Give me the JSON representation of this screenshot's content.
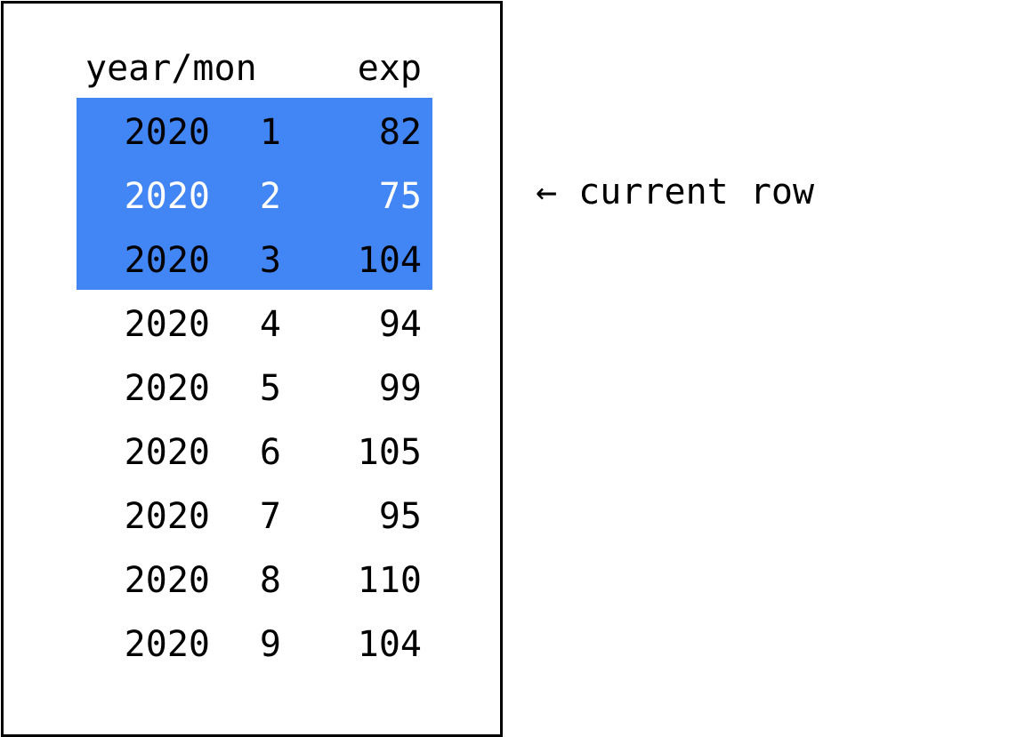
{
  "table": {
    "headers": {
      "year_mon": "year/mon",
      "exp": "exp"
    },
    "rows": [
      {
        "year": "2020",
        "mon": "1",
        "exp": "82"
      },
      {
        "year": "2020",
        "mon": "2",
        "exp": "75"
      },
      {
        "year": "2020",
        "mon": "3",
        "exp": "104"
      },
      {
        "year": "2020",
        "mon": "4",
        "exp": "94"
      },
      {
        "year": "2020",
        "mon": "5",
        "exp": "99"
      },
      {
        "year": "2020",
        "mon": "6",
        "exp": "105"
      },
      {
        "year": "2020",
        "mon": "7",
        "exp": "95"
      },
      {
        "year": "2020",
        "mon": "8",
        "exp": "110"
      },
      {
        "year": "2020",
        "mon": "9",
        "exp": "104"
      }
    ],
    "window_rows": [
      1,
      2,
      3
    ],
    "current_row": 2
  },
  "annotation": {
    "label": "← current row"
  },
  "colors": {
    "window_highlight": "#4285f4",
    "current_row_text": "#ffffff",
    "text": "#000000",
    "frame": "#000000"
  }
}
